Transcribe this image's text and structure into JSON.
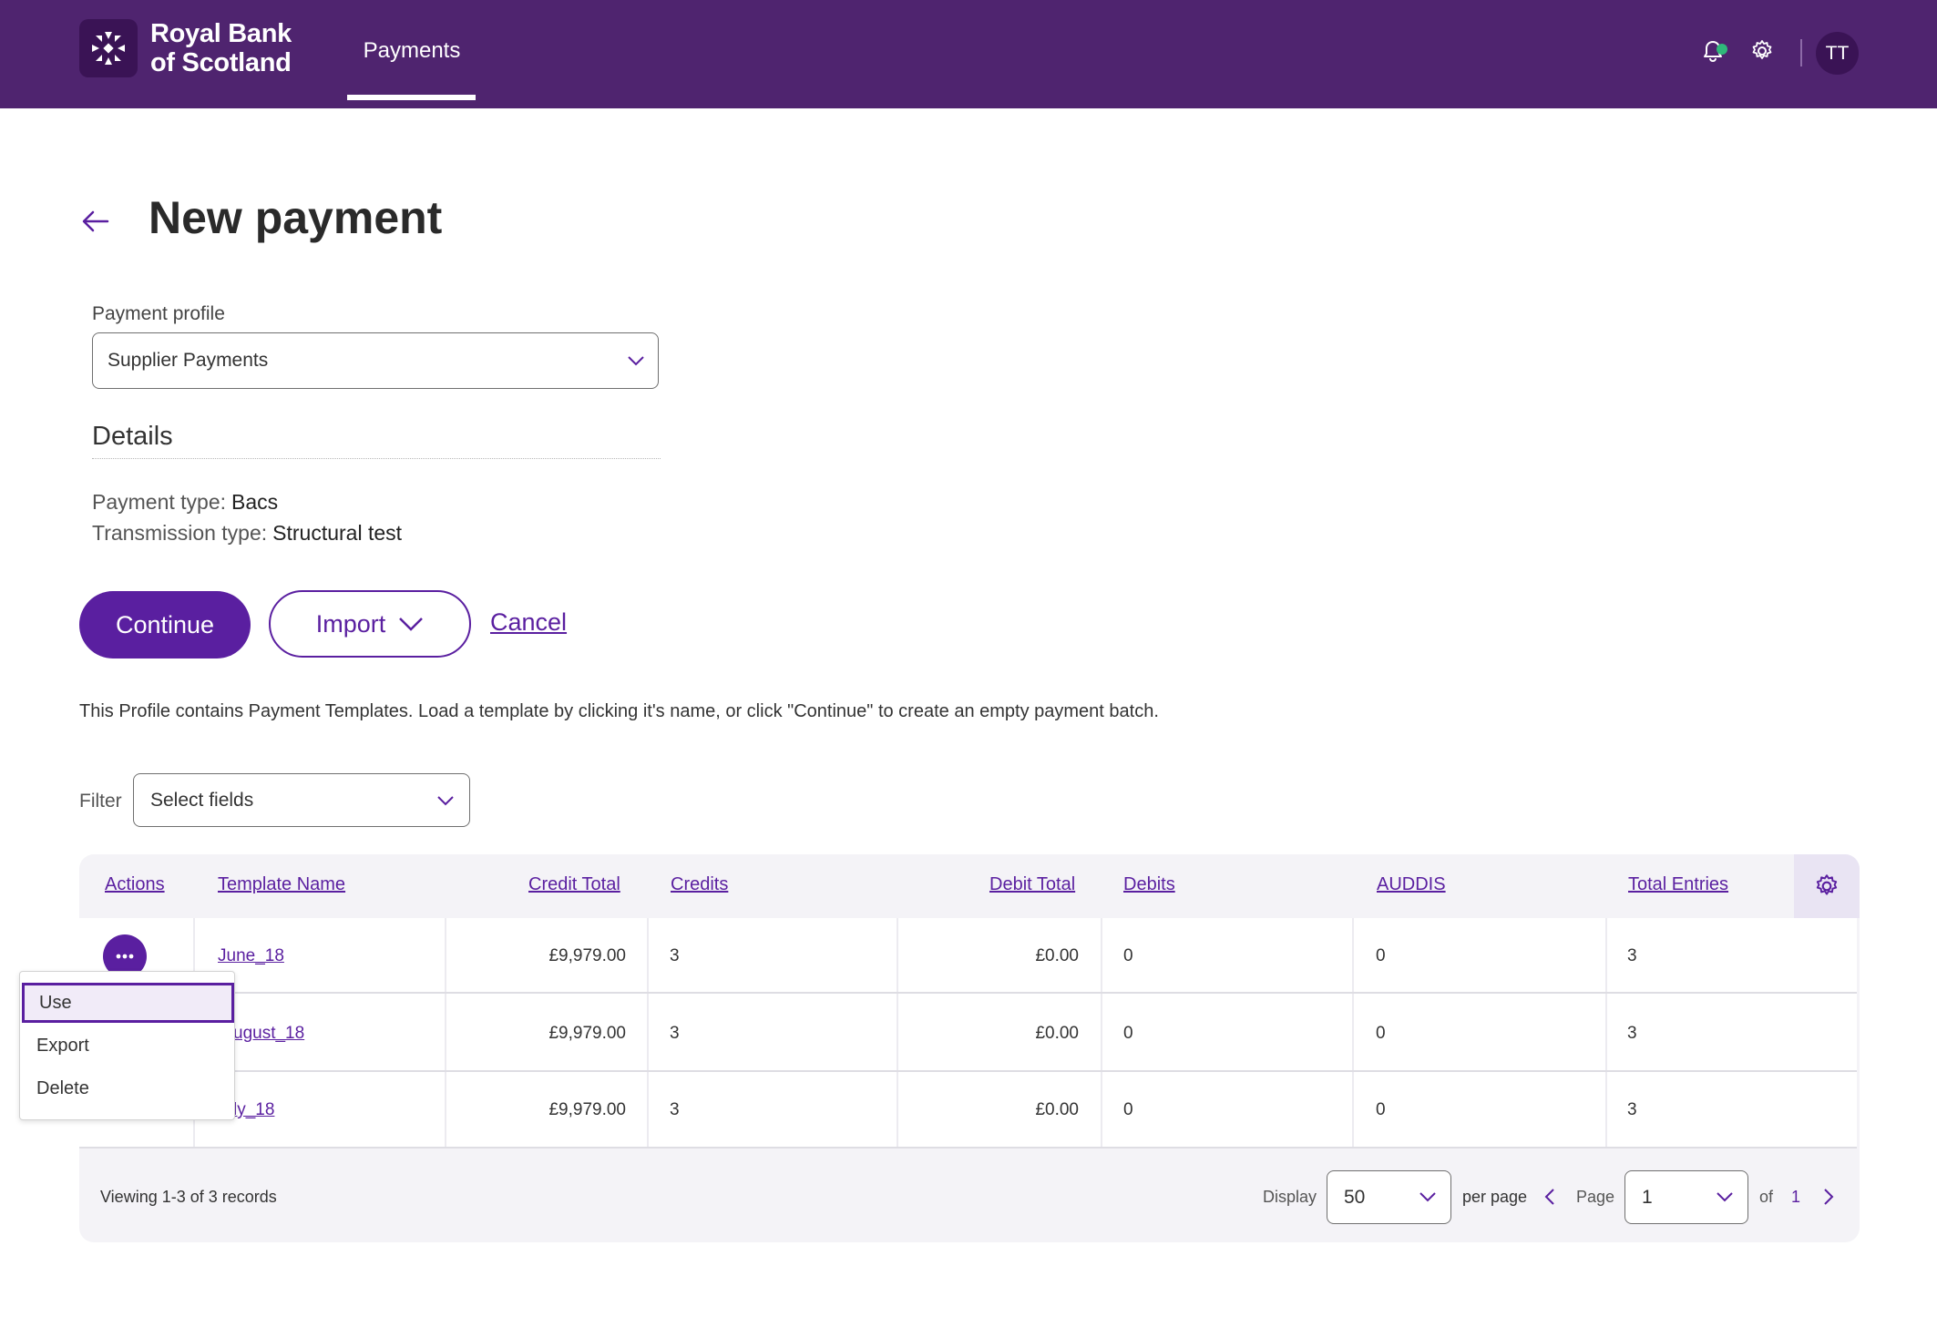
{
  "brand": {
    "name_line1": "Royal Bank",
    "name_line2": "of Scotland"
  },
  "nav": {
    "active_tab": "Payments"
  },
  "user": {
    "initials": "TT"
  },
  "page": {
    "title": "New payment"
  },
  "payment_profile": {
    "label": "Payment profile",
    "value": "Supplier Payments"
  },
  "details": {
    "heading": "Details",
    "payment_type_label": "Payment type:",
    "payment_type_value": "Bacs",
    "transmission_type_label": "Transmission type:",
    "transmission_type_value": "Structural test"
  },
  "buttons": {
    "continue": "Continue",
    "import": "Import",
    "cancel": "Cancel"
  },
  "info_text": "This Profile contains Payment Templates. Load a template by clicking it's name, or click \"Continue\" to create an empty payment batch.",
  "filter": {
    "label": "Filter",
    "placeholder": "Select fields"
  },
  "table": {
    "headers": [
      "Actions",
      "Template Name",
      "Credit Total",
      "Credits",
      "Debit Total",
      "Debits",
      "AUDDIS",
      "Total Entries"
    ],
    "rows": [
      {
        "template_name": "June_18",
        "credit_total": "£9,979.00",
        "credits": "3",
        "debit_total": "£0.00",
        "debits": "0",
        "auddis": "0",
        "total_entries": "3"
      },
      {
        "template_name": "ugust_18",
        "credit_total": "£9,979.00",
        "credits": "3",
        "debit_total": "£0.00",
        "debits": "0",
        "auddis": "0",
        "total_entries": "3"
      },
      {
        "template_name": "ly_18",
        "credit_total": "£9,979.00",
        "credits": "3",
        "debit_total": "£0.00",
        "debits": "0",
        "auddis": "0",
        "total_entries": "3"
      }
    ]
  },
  "actions_menu": {
    "items": [
      "Use",
      "Export",
      "Delete"
    ],
    "selected": "Use"
  },
  "pagination": {
    "viewing": "Viewing 1-3 of 3 records",
    "display_label": "Display",
    "per_page_value": "50",
    "per_page_label": "per page",
    "page_label": "Page",
    "page_value": "1",
    "of_label": "of",
    "total_pages": "1"
  },
  "colors": {
    "header_bg": "#4f246f",
    "primary": "#5a1fa0",
    "notification_dot": "#2fb87a"
  },
  "icons": [
    "bell-icon",
    "gear-icon",
    "back-arrow-icon",
    "chevron-down-icon",
    "more-horizontal-icon",
    "chevron-left-icon",
    "chevron-right-icon"
  ]
}
